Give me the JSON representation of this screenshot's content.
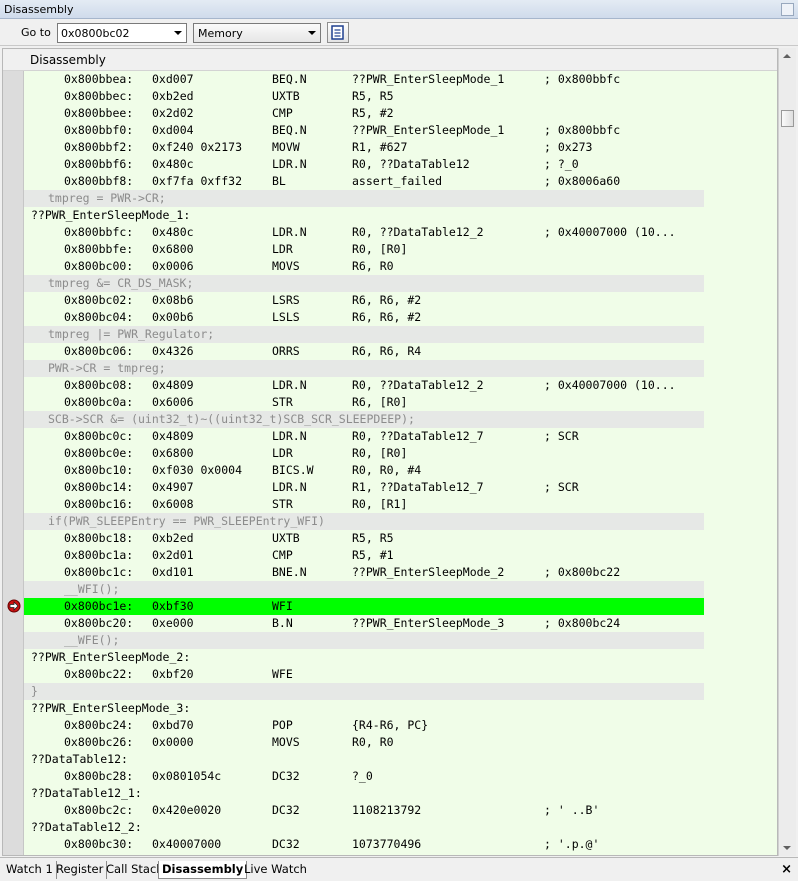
{
  "window": {
    "title": "Disassembly"
  },
  "toolbar": {
    "goto_label": "Go to",
    "goto_value": "0x0800bc02",
    "memory_select": "Memory",
    "button_icon": "document-icon"
  },
  "panel": {
    "header": "Disassembly"
  },
  "rows": [
    {
      "kind": "ins",
      "addr": "0x800bbea:",
      "code": "0xd007",
      "mnem": "BEQ.N",
      "ops": "??PWR_EnterSleepMode_1",
      "cmt": "; 0x800bbfc"
    },
    {
      "kind": "ins",
      "addr": "0x800bbec:",
      "code": "0xb2ed",
      "mnem": "UXTB",
      "ops": "R5, R5",
      "cmt": ""
    },
    {
      "kind": "ins",
      "addr": "0x800bbee:",
      "code": "0x2d02",
      "mnem": "CMP",
      "ops": "R5, #2",
      "cmt": ""
    },
    {
      "kind": "ins",
      "addr": "0x800bbf0:",
      "code": "0xd004",
      "mnem": "BEQ.N",
      "ops": "??PWR_EnterSleepMode_1",
      "cmt": "; 0x800bbfc"
    },
    {
      "kind": "ins",
      "addr": "0x800bbf2:",
      "code": "0xf240 0x2173",
      "mnem": "MOVW",
      "ops": "R1, #627",
      "cmt": "; 0x273"
    },
    {
      "kind": "ins",
      "addr": "0x800bbf6:",
      "code": "0x480c",
      "mnem": "LDR.N",
      "ops": "R0, ??DataTable12",
      "cmt": "; ?_0"
    },
    {
      "kind": "ins",
      "addr": "0x800bbf8:",
      "code": "0xf7fa 0xff32",
      "mnem": "BL",
      "ops": "assert_failed",
      "cmt": "; 0x8006a60"
    },
    {
      "kind": "src",
      "text": "tmpreg = PWR->CR;",
      "indent": 1
    },
    {
      "kind": "label",
      "text": "??PWR_EnterSleepMode_1:"
    },
    {
      "kind": "ins",
      "addr": "0x800bbfc:",
      "code": "0x480c",
      "mnem": "LDR.N",
      "ops": "R0, ??DataTable12_2",
      "cmt": "; 0x40007000 (10..."
    },
    {
      "kind": "ins",
      "addr": "0x800bbfe:",
      "code": "0x6800",
      "mnem": "LDR",
      "ops": "R0, [R0]",
      "cmt": ""
    },
    {
      "kind": "ins",
      "addr": "0x800bc00:",
      "code": "0x0006",
      "mnem": "MOVS",
      "ops": "R6, R0",
      "cmt": ""
    },
    {
      "kind": "src",
      "text": "tmpreg &= CR_DS_MASK;",
      "indent": 1
    },
    {
      "kind": "ins",
      "addr": "0x800bc02:",
      "code": "0x08b6",
      "mnem": "LSRS",
      "ops": "R6, R6, #2",
      "cmt": ""
    },
    {
      "kind": "ins",
      "addr": "0x800bc04:",
      "code": "0x00b6",
      "mnem": "LSLS",
      "ops": "R6, R6, #2",
      "cmt": ""
    },
    {
      "kind": "src",
      "text": "tmpreg |= PWR_Regulator;",
      "indent": 1
    },
    {
      "kind": "ins",
      "addr": "0x800bc06:",
      "code": "0x4326",
      "mnem": "ORRS",
      "ops": "R6, R6, R4",
      "cmt": ""
    },
    {
      "kind": "src",
      "text": "PWR->CR = tmpreg;",
      "indent": 1
    },
    {
      "kind": "ins",
      "addr": "0x800bc08:",
      "code": "0x4809",
      "mnem": "LDR.N",
      "ops": "R0, ??DataTable12_2",
      "cmt": "; 0x40007000 (10..."
    },
    {
      "kind": "ins",
      "addr": "0x800bc0a:",
      "code": "0x6006",
      "mnem": "STR",
      "ops": "R6, [R0]",
      "cmt": ""
    },
    {
      "kind": "src",
      "text": "SCB->SCR &= (uint32_t)~((uint32_t)SCB_SCR_SLEEPDEEP);",
      "indent": 1
    },
    {
      "kind": "ins",
      "addr": "0x800bc0c:",
      "code": "0x4809",
      "mnem": "LDR.N",
      "ops": "R0, ??DataTable12_7",
      "cmt": "; SCR"
    },
    {
      "kind": "ins",
      "addr": "0x800bc0e:",
      "code": "0x6800",
      "mnem": "LDR",
      "ops": "R0, [R0]",
      "cmt": ""
    },
    {
      "kind": "ins",
      "addr": "0x800bc10:",
      "code": "0xf030 0x0004",
      "mnem": "BICS.W",
      "ops": "R0, R0, #4",
      "cmt": ""
    },
    {
      "kind": "ins",
      "addr": "0x800bc14:",
      "code": "0x4907",
      "mnem": "LDR.N",
      "ops": "R1, ??DataTable12_7",
      "cmt": "; SCR"
    },
    {
      "kind": "ins",
      "addr": "0x800bc16:",
      "code": "0x6008",
      "mnem": "STR",
      "ops": "R0, [R1]",
      "cmt": ""
    },
    {
      "kind": "src",
      "text": "if(PWR_SLEEPEntry == PWR_SLEEPEntry_WFI)",
      "indent": 1
    },
    {
      "kind": "ins",
      "addr": "0x800bc18:",
      "code": "0xb2ed",
      "mnem": "UXTB",
      "ops": "R5, R5",
      "cmt": ""
    },
    {
      "kind": "ins",
      "addr": "0x800bc1a:",
      "code": "0x2d01",
      "mnem": "CMP",
      "ops": "R5, #1",
      "cmt": ""
    },
    {
      "kind": "ins",
      "addr": "0x800bc1c:",
      "code": "0xd101",
      "mnem": "BNE.N",
      "ops": "??PWR_EnterSleepMode_2",
      "cmt": "; 0x800bc22"
    },
    {
      "kind": "src",
      "text": "__WFI();",
      "indent": 2
    },
    {
      "kind": "ins",
      "addr": "0x800bc1e:",
      "code": "0xbf30",
      "mnem": "WFI",
      "ops": "",
      "cmt": "",
      "current": true
    },
    {
      "kind": "ins",
      "addr": "0x800bc20:",
      "code": "0xe000",
      "mnem": "B.N",
      "ops": "??PWR_EnterSleepMode_3",
      "cmt": "; 0x800bc24"
    },
    {
      "kind": "src",
      "text": "__WFE();",
      "indent": 2
    },
    {
      "kind": "label",
      "text": "??PWR_EnterSleepMode_2:"
    },
    {
      "kind": "ins",
      "addr": "0x800bc22:",
      "code": "0xbf20",
      "mnem": "WFE",
      "ops": "",
      "cmt": ""
    },
    {
      "kind": "src",
      "text": "}",
      "indent": 0
    },
    {
      "kind": "label",
      "text": "??PWR_EnterSleepMode_3:"
    },
    {
      "kind": "ins",
      "addr": "0x800bc24:",
      "code": "0xbd70",
      "mnem": "POP",
      "ops": "{R4-R6, PC}",
      "cmt": ""
    },
    {
      "kind": "ins",
      "addr": "0x800bc26:",
      "code": "0x0000",
      "mnem": "MOVS",
      "ops": "R0, R0",
      "cmt": ""
    },
    {
      "kind": "label",
      "text": "??DataTable12:"
    },
    {
      "kind": "ins",
      "addr": "0x800bc28:",
      "code": "0x0801054c",
      "mnem": "DC32",
      "ops": "?_0",
      "cmt": ""
    },
    {
      "kind": "label",
      "text": "??DataTable12_1:"
    },
    {
      "kind": "ins",
      "addr": "0x800bc2c:",
      "code": "0x420e0020",
      "mnem": "DC32",
      "ops": "1108213792",
      "cmt": "; ' ..B'"
    },
    {
      "kind": "label",
      "text": "??DataTable12_2:"
    },
    {
      "kind": "ins",
      "addr": "0x800bc30:",
      "code": "0x40007000",
      "mnem": "DC32",
      "ops": "1073770496",
      "cmt": "; '.p.@'"
    }
  ],
  "breakpoint_icon": "current-statement-arrow-icon",
  "tabs": [
    {
      "label": "Watch 1",
      "active": false
    },
    {
      "label": "Register",
      "active": false
    },
    {
      "label": "Call Stack",
      "active": false
    },
    {
      "label": "Disassembly",
      "active": true
    },
    {
      "label": "Live Watch",
      "active": false
    }
  ],
  "tabbar_close": "×",
  "colors": {
    "current_line": "#00ff00",
    "background": "#f0fde8",
    "source_line": "#e6e8e6"
  }
}
